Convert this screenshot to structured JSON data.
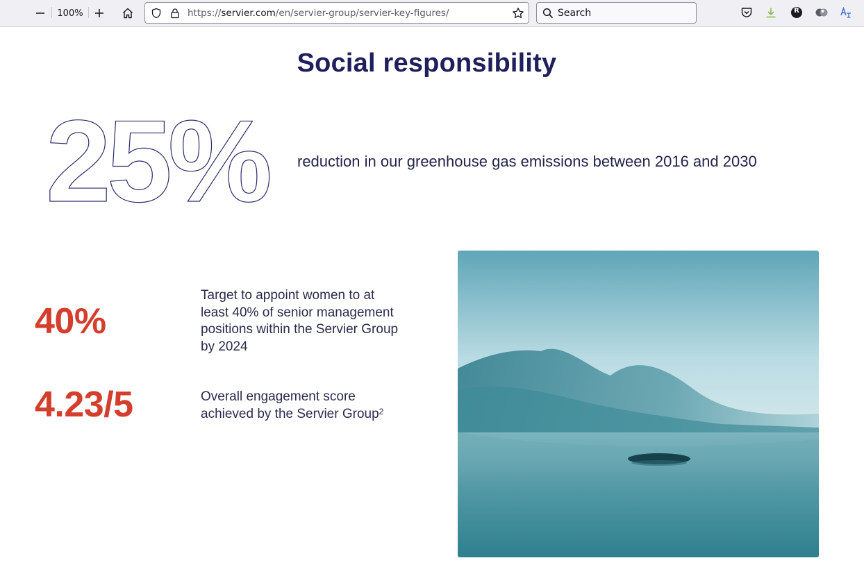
{
  "browser": {
    "zoom_level": "100%",
    "url_prefix": "https://",
    "url_host": "servier.com",
    "url_path": "/en/servier-group/servier-key-figures/",
    "search_placeholder": "Search",
    "profile_initial": "R"
  },
  "page": {
    "heading": "Social responsibility",
    "main_figure": {
      "value": "25%",
      "description": "reduction in our greenhouse gas emissions between 2016 and 2030"
    },
    "stats": [
      {
        "value": "40%",
        "description": "Target to appoint women to at least 40% of senior management positions within the Servier Group by 2024"
      },
      {
        "value": "4.23/5",
        "description": "Overall engagement score achieved by the Servier Group",
        "footnote": "2"
      }
    ]
  },
  "colors": {
    "heading": "#1e1f5b",
    "accent_red": "#d43e2d",
    "outline_figure": "#2a2b6a"
  }
}
